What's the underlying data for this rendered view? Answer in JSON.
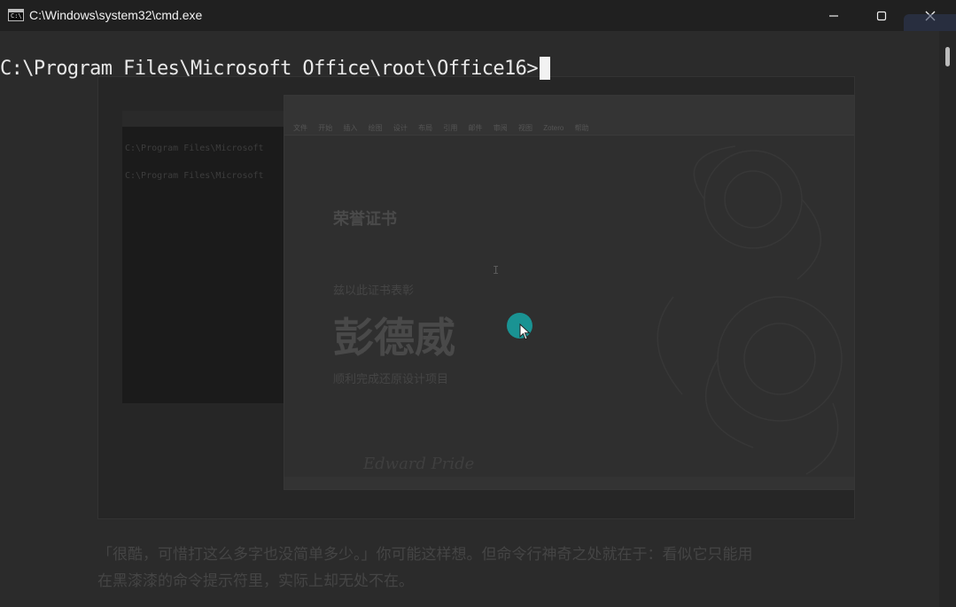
{
  "window": {
    "title": "C:\\Windows\\system32\\cmd.exe",
    "icon": "cmd-window-icon",
    "icon_text": "C:\\",
    "controls": {
      "minimize": "minimize-icon",
      "maximize": "maximize-icon",
      "close": "close-icon"
    }
  },
  "console": {
    "prompt": "C:\\Program Files\\Microsoft Office\\root\\Office16>",
    "foreground": "#e8e8e8",
    "background": "#2b2b2b"
  },
  "background_ghost": {
    "cmd_lines": [
      "C:\\Program Files\\Microsoft",
      "C:\\Program Files\\Microsoft"
    ],
    "doc_menu": "文件 开始 插入 绘图 设计 布局 引用 邮件 审阅 视图 Zotero 帮助",
    "doc_title": "荣誉证书",
    "doc_subtitle": "兹以此证书表彰",
    "doc_name": "彭德威",
    "doc_description": "顺利完成还原设计项目",
    "doc_signature": "Edward Pride",
    "paragraph_line1": "「很酷，可惜打这么多字也没简单多少。」你可能这样想。但命令行神奇之处就在于：看似它只能用",
    "paragraph_line2": "在黑漆漆的命令提示符里，实际上却无处不在。"
  },
  "accent": "#1a9393"
}
